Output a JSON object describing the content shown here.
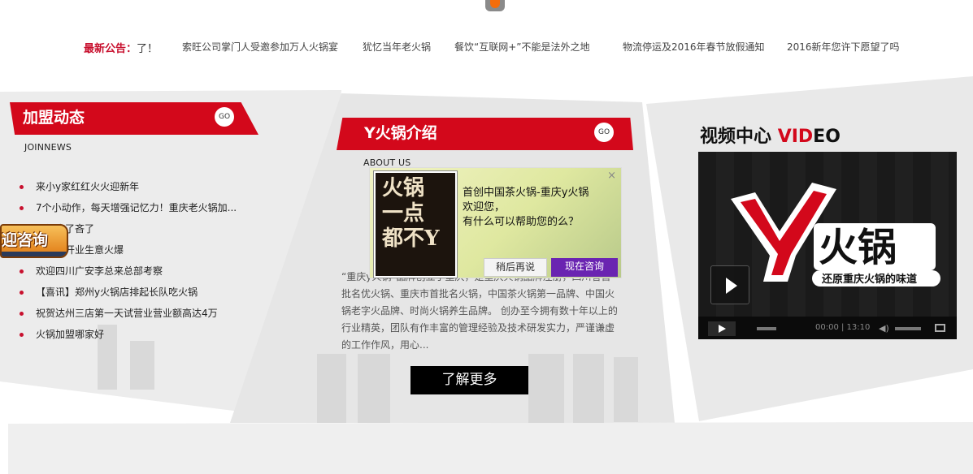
{
  "notice": {
    "label": "最新公告：",
    "label_tail": "了！",
    "items": [
      "索旺公司掌门人受邀参加万人火锅宴",
      "犹忆当年老火锅",
      "餐饮“互联网+”不能是法外之地",
      "物流停运及2016年春节放假通知",
      "2016新年您许下愿望了吗"
    ]
  },
  "join": {
    "title": "加盟动态",
    "go": "GO",
    "subtitle": "JOINNEWS",
    "items": [
      "来小y家红红火火迎新年",
      "7个小动作，每天增强记忆力！重庆老火锅加...",
      "火锅店了吝了",
      "火锅店开业生意火爆",
      "欢迎四川广安李总来总部考察",
      "【喜讯】郑州y火锅店排起长队吃火锅",
      "祝贺达州三店第一天试营业营业额高达4万",
      "火锅加盟哪家好"
    ]
  },
  "intro": {
    "title": "Y火锅介绍",
    "go": "GO",
    "subtitle": "ABOUT US",
    "text": "“重庆y火锅”品牌创立于重庆，是重庆火锅品牌注册，四川省首批名优火锅、重庆市首批名火锅，中国茶火锅第一品牌、中国火锅老字火品牌、时尚火锅养生品牌。 创办至今拥有数十年以上的行业精英，团队有作丰富的管理经验及技术研发实力，严谨谦虚的工作作风，用心...",
    "more": "了解更多"
  },
  "video": {
    "title_a": "视频中心",
    "title_b": "VID",
    "title_c": "EO",
    "logo_y": "Y",
    "logo_text": "火锅",
    "slogan": "还原重庆火锅的味道",
    "time": "00:00 | 13:10"
  },
  "chat": {
    "close": "×",
    "image_text": "火锅\n一点\n都不Y",
    "line1": "首创中国茶火锅-重庆y火锅",
    "line2": "欢迎您，",
    "line3": "有什么可以帮助您的么？",
    "later": "稍后再说",
    "now": "现在咨询"
  },
  "float_tag": "迎咨询"
}
